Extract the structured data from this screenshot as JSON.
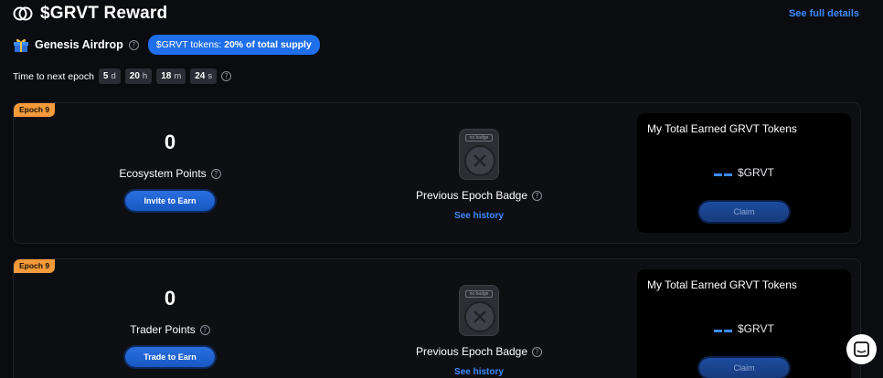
{
  "header": {
    "title": "$GRVT Reward",
    "see_full": "See full details"
  },
  "airdrop": {
    "label": "Genesis Airdrop",
    "badge_prefix": "$GRVT tokens:",
    "badge_value": "20% of total supply"
  },
  "timer": {
    "label": "Time to next epoch",
    "days": "5",
    "days_unit": "d",
    "hours": "20",
    "hours_unit": "h",
    "minutes": "18",
    "minutes_unit": "m",
    "seconds": "24",
    "seconds_unit": "s"
  },
  "cards": [
    {
      "epoch": "Epoch 9",
      "points_value": "0",
      "points_label": "Ecosystem Points",
      "action_label": "Invite to Earn",
      "badge_image_text": "no badge",
      "badge_label": "Previous Epoch Badge",
      "history_label": "See history",
      "earned_title": "My Total Earned GRVT Tokens",
      "earned_unit": "$GRVT",
      "claim_label": "Claim"
    },
    {
      "epoch": "Epoch 9",
      "points_value": "0",
      "points_label": "Trader Points",
      "action_label": "Trade to Earn",
      "badge_image_text": "no badge",
      "badge_label": "Previous Epoch Badge",
      "history_label": "See history",
      "earned_title": "My Total Earned GRVT Tokens",
      "earned_unit": "$GRVT",
      "claim_label": "Claim"
    }
  ],
  "colors": {
    "accent": "#3d8bff",
    "primary_button": "#1f6feb",
    "epoch_tag": "#f39a3a",
    "background": "#0b0c0f"
  },
  "icons": [
    "grvt-logo-icon",
    "gift-icon",
    "help-icon",
    "x-icon",
    "chat-icon"
  ]
}
